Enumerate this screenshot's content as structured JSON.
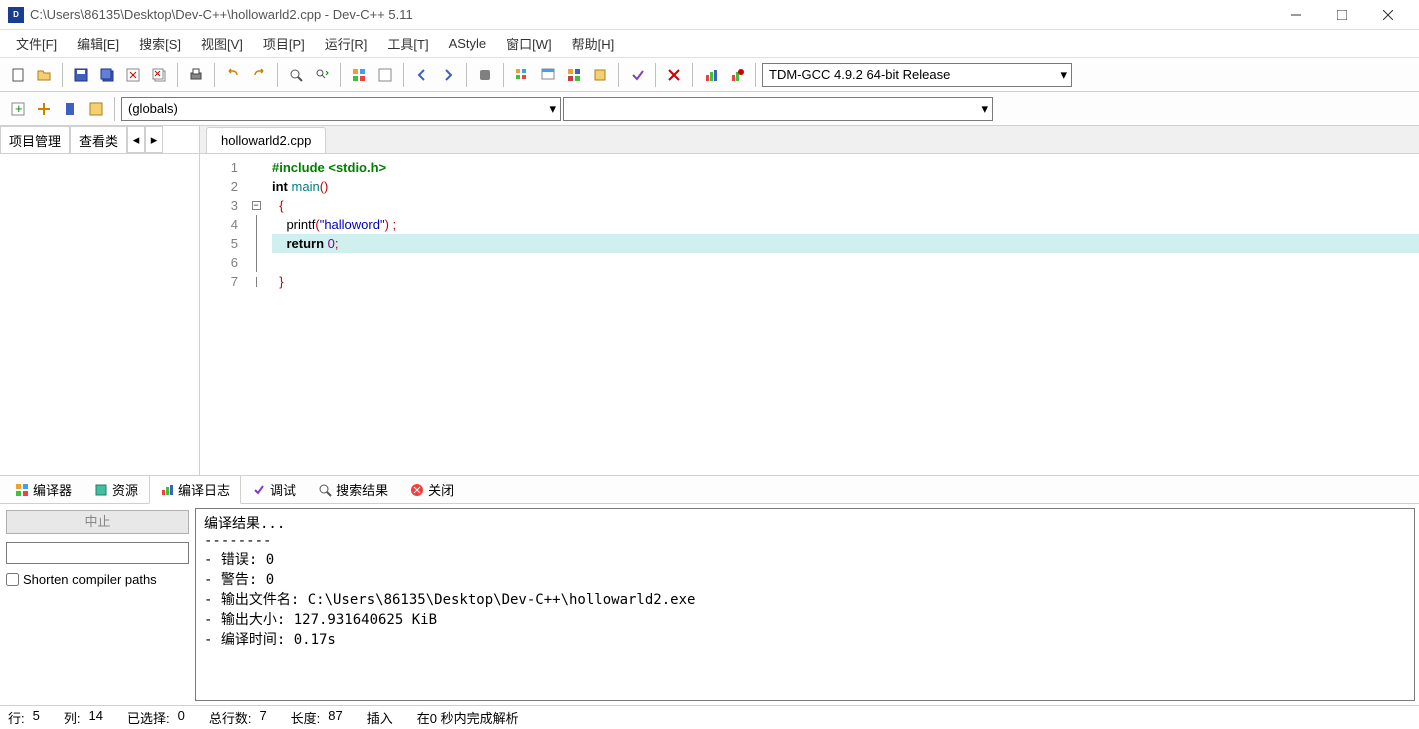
{
  "title": "C:\\Users\\86135\\Desktop\\Dev-C++\\hollowarld2.cpp - Dev-C++ 5.11",
  "menus": [
    "文件[F]",
    "编辑[E]",
    "搜索[S]",
    "视图[V]",
    "项目[P]",
    "运行[R]",
    "工具[T]",
    "AStyle",
    "窗口[W]",
    "帮助[H]"
  ],
  "compilerCombo": "TDM-GCC 4.9.2 64-bit Release",
  "globalsCombo": "(globals)",
  "sideTabs": {
    "project": "项目管理",
    "classes": "查看类"
  },
  "editorTab": "hollowarld2.cpp",
  "code": {
    "lines": [
      {
        "n": 1,
        "html": "<span class='kw-green'>#include &lt;stdio.h&gt;</span>"
      },
      {
        "n": 2,
        "html": "<span class='kw-bold'>int</span> <span class='kw-teal'>main</span><span class='kw-red'>()</span>"
      },
      {
        "n": 3,
        "html": "  <span class='kw-red'>{</span>"
      },
      {
        "n": 4,
        "html": "    printf<span class='kw-red'>(</span><span class='kw-blue'>\"halloword\"</span><span class='kw-red'>)</span> <span class='kw-red'>;</span>"
      },
      {
        "n": 5,
        "html": "    <span class='kw-bold'>return</span> <span class='kw-purple'>0</span><span class='kw-red'>;</span>",
        "hl": true
      },
      {
        "n": 6,
        "html": ""
      },
      {
        "n": 7,
        "html": "  <span class='kw-red'>}</span>"
      }
    ]
  },
  "bottomTabs": {
    "compiler": "编译器",
    "resources": "资源",
    "log": "编译日志",
    "debug": "调试",
    "search": "搜索结果",
    "close": "关闭"
  },
  "abortBtn": "中止",
  "shortenPaths": "Shorten compiler paths",
  "logText": "编译结果...\n--------\n- 错误: 0\n- 警告: 0\n- 输出文件名: C:\\Users\\86135\\Desktop\\Dev-C++\\hollowarld2.exe\n- 输出大小: 127.931640625 KiB\n- 编译时间: 0.17s",
  "status": {
    "rowLabel": "行:",
    "row": "5",
    "colLabel": "列:",
    "col": "14",
    "selLabel": "已选择:",
    "sel": "0",
    "totalLabel": "总行数:",
    "total": "7",
    "lenLabel": "长度:",
    "len": "87",
    "mode": "插入",
    "parse": "在0 秒内完成解析"
  }
}
